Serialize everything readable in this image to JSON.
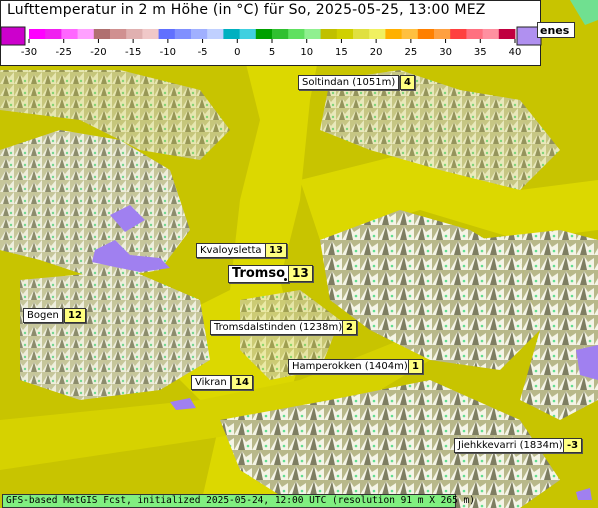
{
  "header": {
    "title": "Lufttemperatur in 2 m Höhe (in °C) für So, 2025-05-25, 13:00 MEZ"
  },
  "legend": {
    "ticks": [
      "-30",
      "-25",
      "-20",
      "-15",
      "-10",
      "-5",
      "0",
      "5",
      "10",
      "15",
      "20",
      "25",
      "30",
      "35",
      "40"
    ],
    "colors": [
      "#ff00ff",
      "#f020f0",
      "#ff66ff",
      "#ffa0ff",
      "#b07070",
      "#d09090",
      "#e0b0b0",
      "#f0c8c8",
      "#6070ff",
      "#8090ff",
      "#a0b0ff",
      "#c0d0ff",
      "#00b0c0",
      "#40d0e0",
      "#00a000",
      "#30c030",
      "#60e060",
      "#90f090",
      "#c0c000",
      "#d0d000",
      "#e0e040",
      "#f0f060",
      "#ffb000",
      "#ffc040",
      "#ff8000",
      "#ffa040",
      "#ff4040",
      "#ff7080",
      "#ff90a0",
      "#c00040"
    ],
    "low_color": "#cc00cc",
    "high_color": "#b090f0"
  },
  "corner_label": "enes",
  "places": [
    {
      "name": "Soltindan (1051m)",
      "temp": "4"
    },
    {
      "name": "Kvaloysletta",
      "temp": "13"
    },
    {
      "name": "Tromso",
      "temp": "13"
    },
    {
      "name": "Bogen",
      "temp": "12"
    },
    {
      "name": "Tromsdalstinden (1238m)",
      "temp": "2"
    },
    {
      "name": "Hamperokken (1404m)",
      "temp": "1"
    },
    {
      "name": "Vikran",
      "temp": "14"
    },
    {
      "name": "Jiehkkevarri (1834m)",
      "temp": "-3"
    }
  ],
  "footer": "GFS-based MetGIS Fcst, initialized 2025-05-24, 12:00 UTC  (resolution 91 m X 265 m)",
  "map_colors": {
    "valley": "#c8c400",
    "lowland": "#dada00",
    "fjord": "#e0dc00",
    "ridge_light": "#f2f2e8",
    "ridge_shadow": "#8a8a6a",
    "cold": "#a080f0",
    "mild_green": "#70e090"
  }
}
